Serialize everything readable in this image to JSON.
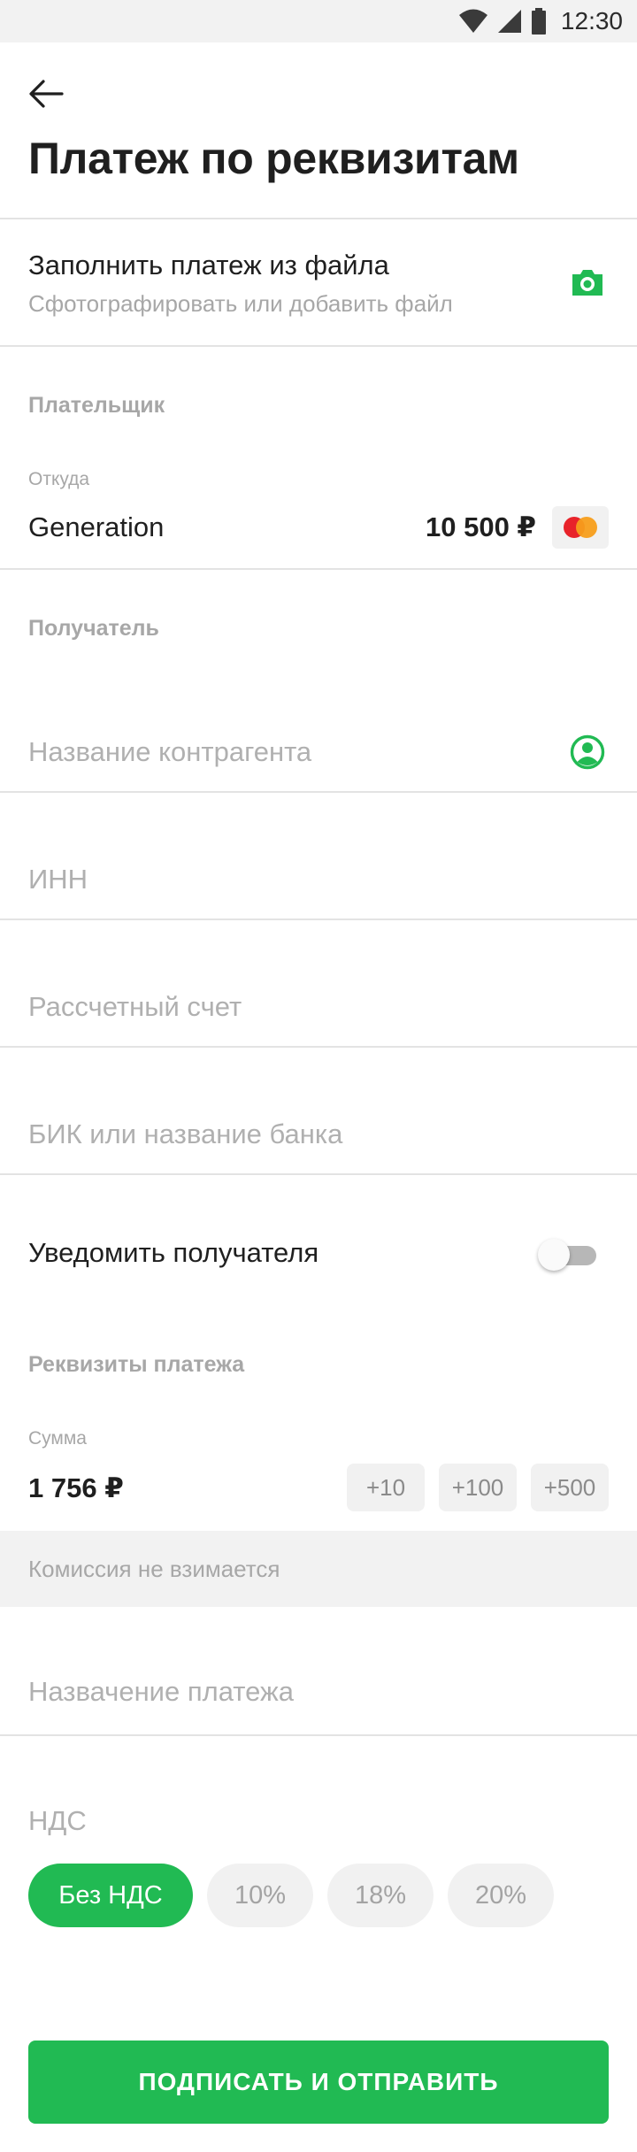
{
  "status_bar": {
    "time": "12:30"
  },
  "header": {
    "title": "Платеж по реквизитам"
  },
  "fill_from_file": {
    "title": "Заполнить платеж из файла",
    "subtitle": "Сфотографировать или добавить файл",
    "icon": "camera-icon"
  },
  "payer": {
    "section_label": "Плательщик",
    "from_label": "Откуда",
    "account_name": "Generation",
    "amount": "10 500 ₽",
    "card_icon": "mastercard-icon"
  },
  "recipient": {
    "section_label": "Получатель",
    "name_placeholder": "Название контрагента",
    "inn_placeholder": "ИНН",
    "account_placeholder": "Рассчетный счет",
    "bank_placeholder": "БИК или название банка",
    "contact_icon": "contact-icon"
  },
  "notify": {
    "label": "Уведомить получателя",
    "enabled": false
  },
  "payment_details": {
    "section_label": "Реквизиты платежа",
    "sum_label": "Сумма",
    "sum_value": "1 756 ₽",
    "quick_add": [
      "+10",
      "+100",
      "+500"
    ],
    "commission": "Комиссия не взимается",
    "purpose_placeholder": "Назвачение платежа"
  },
  "vat": {
    "label": "НДС",
    "options": [
      "Без НДС",
      "10%",
      "18%",
      "20%"
    ],
    "selected": "Без НДС"
  },
  "submit_label": "ПОДПИСАТЬ И ОТПРАВИТЬ",
  "colors": {
    "accent": "#21ba53",
    "muted_text": "#a7a7a7",
    "divider": "#e3e3e3"
  }
}
